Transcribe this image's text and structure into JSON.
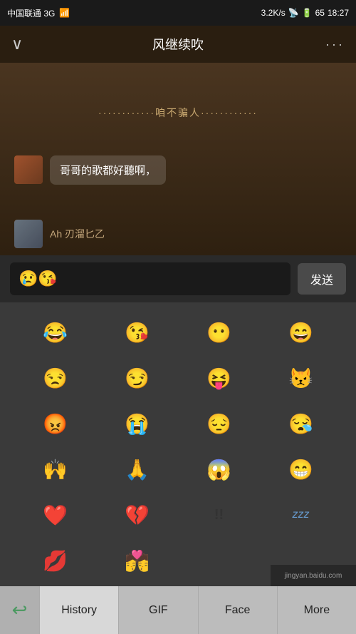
{
  "status_bar": {
    "carrier": "中国联通 3G",
    "speed": "3.2K/s",
    "time": "18:27",
    "battery": "65"
  },
  "title_bar": {
    "title": "风继续吹",
    "back_icon": "∨",
    "more_icon": "···"
  },
  "chat": {
    "comment1": {
      "text": "············咱不骗人············"
    },
    "comment2": {
      "bubble_text": "哥哥的歌都好聽啊，"
    },
    "comment3": {
      "prefix": "Ah",
      "text": "刃溜匕乙"
    }
  },
  "input": {
    "emoji_input": "😢😘",
    "send_label": "发送"
  },
  "emoji_rows": [
    [
      "😂",
      "😘",
      "😶",
      "😄"
    ],
    [
      "😒",
      "😏",
      "😝",
      "😾"
    ],
    [
      "😡",
      "😭",
      "😔",
      "😪"
    ],
    [
      "🙌",
      "🙏",
      "😱",
      "😁"
    ],
    [
      "❤️",
      "💔",
      "!!",
      "zzz"
    ],
    [
      "💋",
      "💏",
      "",
      ""
    ]
  ],
  "bottom_tabs": {
    "back_icon": "↩",
    "tabs": [
      {
        "label": "History",
        "active": true
      },
      {
        "label": "GIF",
        "active": false
      },
      {
        "label": "Face",
        "active": false
      },
      {
        "label": "More",
        "active": false
      }
    ]
  },
  "watermark": "jingyan.baidu.com"
}
